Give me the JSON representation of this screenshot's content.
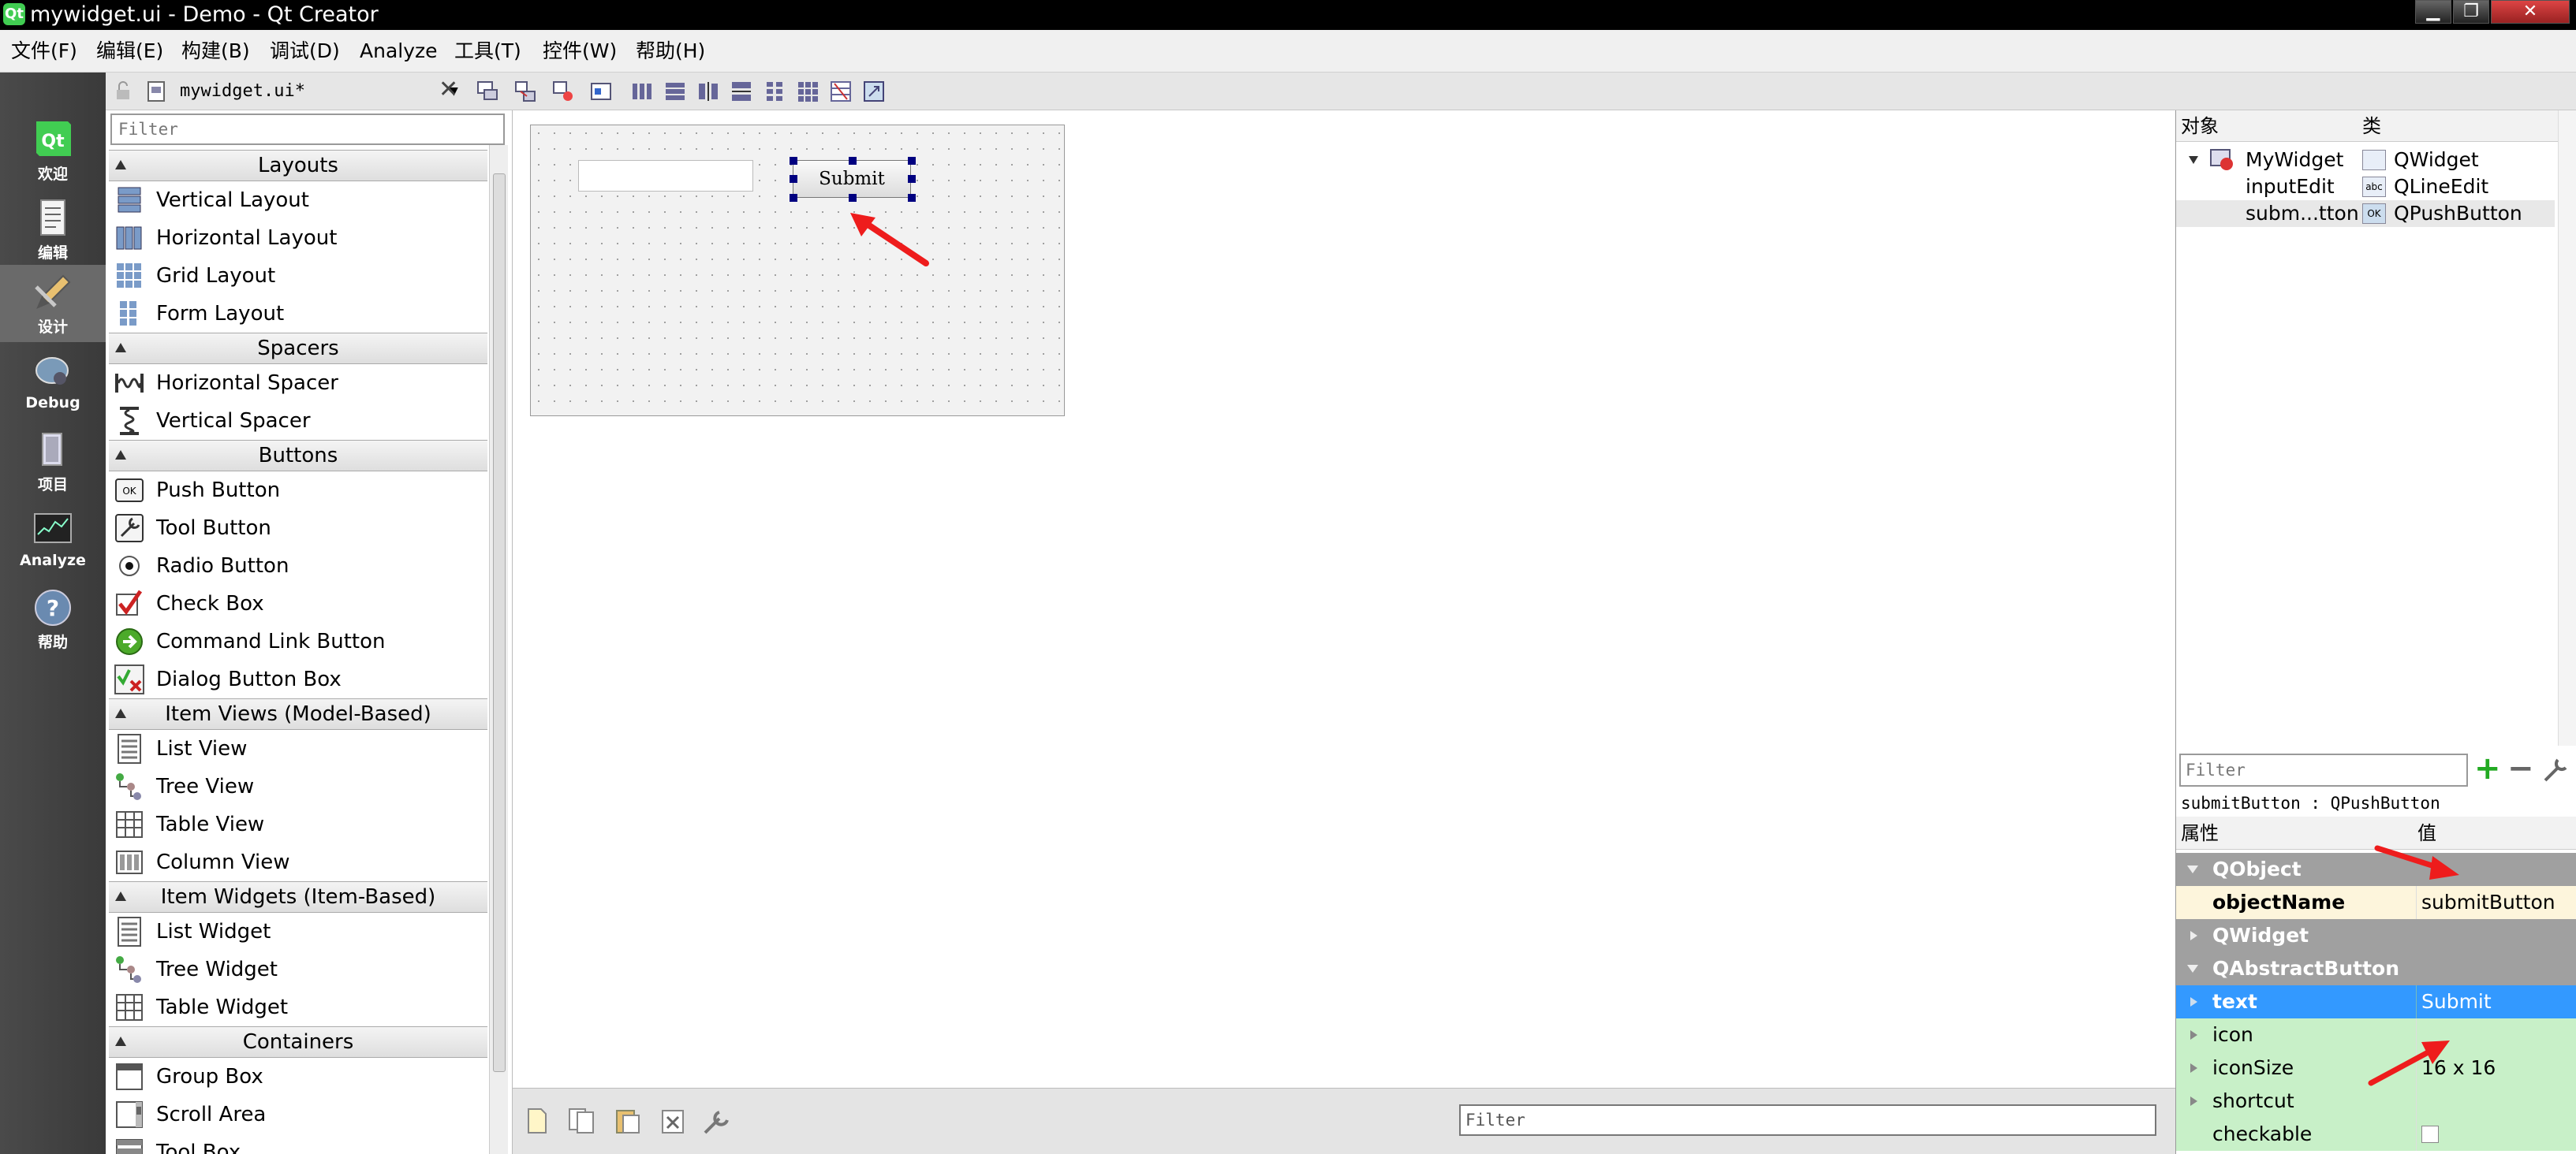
{
  "window": {
    "title": "mywidget.ui - Demo - Qt Creator",
    "app_icon_text": "Qt"
  },
  "menu": [
    "文件(F)",
    "编辑(E)",
    "构建(B)",
    "调试(D)",
    "Analyze",
    "工具(T)",
    "控件(W)",
    "帮助(H)"
  ],
  "modes": [
    {
      "label": "欢迎",
      "icon": "qt-logo-icon"
    },
    {
      "label": "编辑",
      "icon": "edit-document-icon"
    },
    {
      "label": "设计",
      "icon": "design-pencil-icon",
      "active": true
    },
    {
      "label": "Debug",
      "icon": "debug-bug-icon"
    },
    {
      "label": "项目",
      "icon": "project-icon"
    },
    {
      "label": "Analyze",
      "icon": "analyze-monitor-icon"
    },
    {
      "label": "帮助",
      "icon": "help-question-icon"
    }
  ],
  "editor": {
    "open_file": "mywidget.ui*"
  },
  "widget_box": {
    "filter_placeholder": "Filter",
    "categories": [
      {
        "title": "Layouts",
        "items": [
          "Vertical Layout",
          "Horizontal Layout",
          "Grid Layout",
          "Form Layout"
        ]
      },
      {
        "title": "Spacers",
        "items": [
          "Horizontal Spacer",
          "Vertical Spacer"
        ]
      },
      {
        "title": "Buttons",
        "items": [
          "Push Button",
          "Tool Button",
          "Radio Button",
          "Check Box",
          "Command Link Button",
          "Dialog Button Box"
        ]
      },
      {
        "title": "Item Views (Model-Based)",
        "items": [
          "List View",
          "Tree View",
          "Table View",
          "Column View"
        ]
      },
      {
        "title": "Item Widgets (Item-Based)",
        "items": [
          "List Widget",
          "Tree Widget",
          "Table Widget"
        ]
      },
      {
        "title": "Containers",
        "items": [
          "Group Box",
          "Scroll Area",
          "Tool Box"
        ]
      }
    ]
  },
  "form": {
    "button_text": "Submit"
  },
  "action_editor": {
    "filter_placeholder": "Filter"
  },
  "object_inspector": {
    "col_object": "对象",
    "col_class": "类",
    "rows": [
      {
        "object": "MyWidget",
        "class": "QWidget"
      },
      {
        "object": "inputEdit",
        "class": "QLineEdit"
      },
      {
        "object": "subm...tton",
        "class": "QPushButton"
      }
    ]
  },
  "property_editor": {
    "filter_placeholder": "Filter",
    "class_label": "submitButton : QPushButton",
    "col_property": "属性",
    "col_value": "值",
    "rows": [
      {
        "type": "group",
        "name": "QObject"
      },
      {
        "type": "prop",
        "name": "objectName",
        "value": "submitButton"
      },
      {
        "type": "group",
        "name": "QWidget"
      },
      {
        "type": "group",
        "name": "QAbstractButton"
      },
      {
        "type": "prop",
        "name": "text",
        "value": "Submit",
        "selected": true
      },
      {
        "type": "prop",
        "name": "icon",
        "value": ""
      },
      {
        "type": "prop",
        "name": "iconSize",
        "value": "16 x 16"
      },
      {
        "type": "prop",
        "name": "shortcut",
        "value": ""
      },
      {
        "type": "prop",
        "name": "checkable",
        "value": ""
      }
    ]
  },
  "colors": {
    "selection": "#3399ff",
    "group_row": "#a0a0a0",
    "object_row": "#fdf5dc",
    "green_row": "#c8f0c8",
    "annotation_arrow": "#ee1c1c"
  }
}
